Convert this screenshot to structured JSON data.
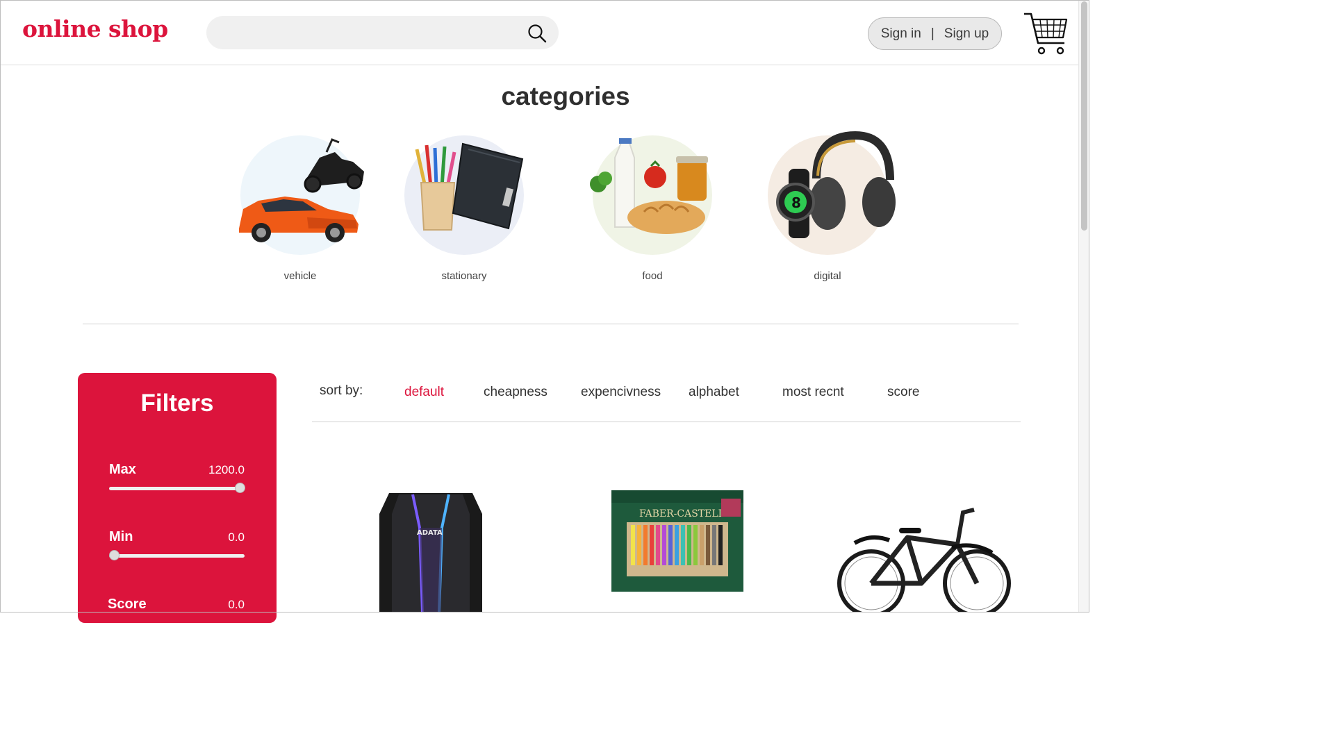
{
  "header": {
    "logo": "online shop",
    "search": {
      "placeholder": "",
      "value": ""
    },
    "auth": {
      "sign_in": "Sign in",
      "separator": "|",
      "sign_up": "Sign up"
    }
  },
  "categories": {
    "title": "categories",
    "items": [
      {
        "label": "vehicle"
      },
      {
        "label": "stationary"
      },
      {
        "label": "food"
      },
      {
        "label": "digital"
      }
    ]
  },
  "filters": {
    "title": "Filters",
    "max": {
      "label": "Max",
      "value": "1200.0",
      "fraction": 1.0
    },
    "min": {
      "label": "Min",
      "value": "0.0",
      "fraction": 0.0
    },
    "score": {
      "label": "Score",
      "value": "0.0",
      "fraction": 0.0
    }
  },
  "sort": {
    "label": "sort by:",
    "options": [
      "default",
      "cheapness",
      "expencivness",
      "alphabet",
      "most recnt",
      "score"
    ],
    "active": "default"
  },
  "products": [
    {
      "brand_text": "ADATA"
    },
    {
      "brand_text": "FABER-CASTELL"
    },
    {
      "brand_text": ""
    }
  ],
  "colors": {
    "brand": "#dc143c",
    "filter_panel": "#dc143c"
  }
}
